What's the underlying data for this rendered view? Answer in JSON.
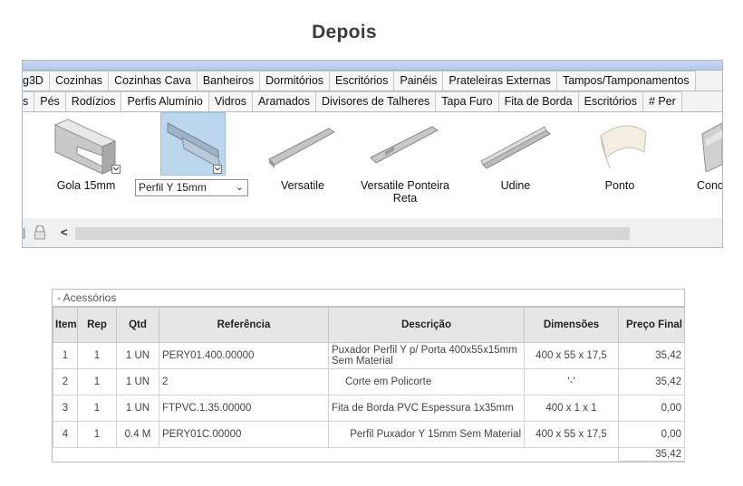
{
  "heading": "Depois",
  "tabs_row1": [
    "g3D",
    "Cozinhas",
    "Cozinhas Cava",
    "Banheiros",
    "Dormitórios",
    "Escritórios",
    "Painéis",
    "Prateleiras Externas",
    "Tampos/Tamponamentos"
  ],
  "tabs_row2": [
    "s",
    "Pés",
    "Rodízios",
    "Perfis Alumínio",
    "Vidros",
    "Aramados",
    "Divisores de Talheres",
    "Tapa Furo",
    "Fita de Borda",
    "Escritórios",
    "# Per"
  ],
  "gallery": {
    "items": [
      {
        "label": "Gola 15mm"
      },
      {
        "label": "Perfil Y 15mm"
      },
      {
        "label": "Versatile"
      },
      {
        "label": "Versatile Ponteira Reta"
      },
      {
        "label": "Udine"
      },
      {
        "label": "Ponto"
      },
      {
        "label": "Conc"
      }
    ],
    "combo_value": "Perfil Y 15mm"
  },
  "bottom": {
    "scroll_left": "<"
  },
  "table": {
    "section": "- Acessórios",
    "headers": [
      "Item",
      "Rep",
      "Qtd",
      "Referência",
      "Descrição",
      "Dimensões",
      "Preço Final"
    ],
    "rows": [
      {
        "item": "1",
        "rep": "1",
        "qtd": "1 UN",
        "ref": "PERY01.400.00000",
        "desc": "Puxador Perfil Y p/ Porta 400x55x15mm Sem Material",
        "dim": "400 x 55 x 17,5",
        "price": "35,42"
      },
      {
        "item": "2",
        "rep": "1",
        "qtd": "1 UN",
        "ref": "2",
        "desc": "Corte em Policorte",
        "dim": "'-'",
        "price": "35,42"
      },
      {
        "item": "3",
        "rep": "1",
        "qtd": "1 UN",
        "ref": "FTPVC.1.35.00000",
        "desc": "Fita de Borda PVC Espessura 1x35mm",
        "dim": "400 x 1 x 1",
        "price": "0,00"
      },
      {
        "item": "4",
        "rep": "1",
        "qtd": "0.4 M",
        "ref": "PERY01C.00000",
        "desc": "Perfil Puxador Y 15mm Sem Material",
        "dim": "400 x 55 x 17,5",
        "price": "0,00"
      }
    ],
    "total": "35,42"
  }
}
